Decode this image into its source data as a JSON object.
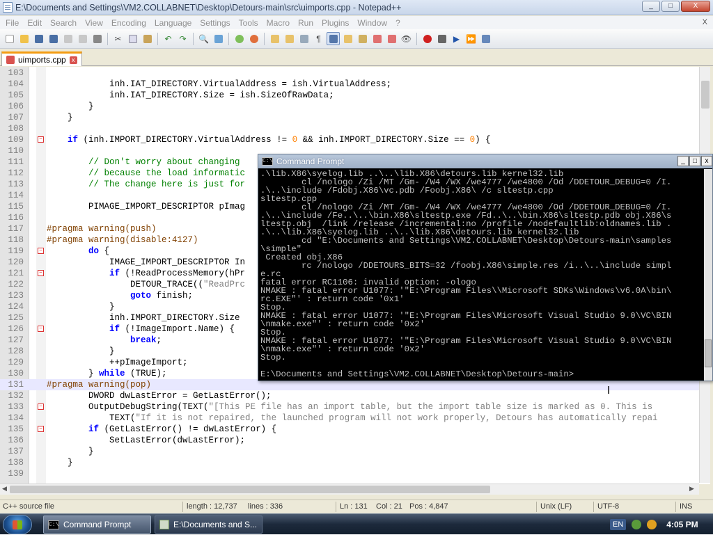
{
  "window": {
    "title": "E:\\Documents and Settings\\VM2.COLLABNET\\Desktop\\Detours-main\\src\\uimports.cpp - Notepad++",
    "min": "_",
    "max": "□",
    "close": "X"
  },
  "menu": [
    "File",
    "Edit",
    "Search",
    "View",
    "Encoding",
    "Language",
    "Settings",
    "Tools",
    "Macro",
    "Run",
    "Plugins",
    "Window",
    "?"
  ],
  "menu_close": "X",
  "tab": {
    "label": "uimports.cpp",
    "close": "x"
  },
  "editor": {
    "lines": [
      {
        "n": "103",
        "h": ""
      },
      {
        "n": "104",
        "h": "            inh.IAT_DIRECTORY.VirtualAddress = ish.VirtualAddress;"
      },
      {
        "n": "105",
        "h": "            inh.IAT_DIRECTORY.Size = ish.SizeOfRawData;"
      },
      {
        "n": "106",
        "h": "        }"
      },
      {
        "n": "107",
        "h": "    }"
      },
      {
        "n": "108",
        "h": ""
      },
      {
        "n": "109",
        "h": "    <span class=\"kw\">if</span> (inh.IMPORT_DIRECTORY.VirtualAddress != <span class=\"nm\">0</span> &amp;&amp; inh.IMPORT_DIRECTORY.Size == <span class=\"nm\">0</span>) {",
        "fold": "-"
      },
      {
        "n": "110",
        "h": ""
      },
      {
        "n": "111",
        "h": "        <span class=\"cm\">// Don't worry about changing</span>"
      },
      {
        "n": "112",
        "h": "        <span class=\"cm\">// because the load informatic</span>"
      },
      {
        "n": "113",
        "h": "        <span class=\"cm\">// The change here is just for</span>"
      },
      {
        "n": "114",
        "h": ""
      },
      {
        "n": "115",
        "h": "        PIMAGE_IMPORT_DESCRIPTOR pImag"
      },
      {
        "n": "116",
        "h": ""
      },
      {
        "n": "117",
        "h": "<span class=\"pp\">#pragma warning(push)</span>"
      },
      {
        "n": "118",
        "h": "<span class=\"pp\">#pragma warning(disable:4127)</span>"
      },
      {
        "n": "119",
        "h": "        <span class=\"kw\">do</span> {",
        "fold": "-"
      },
      {
        "n": "120",
        "h": "            IMAGE_IMPORT_DESCRIPTOR In"
      },
      {
        "n": "121",
        "h": "            <span class=\"kw\">if</span> (!ReadProcessMemory(hPr",
        "fold": "-"
      },
      {
        "n": "122",
        "h": "                DETOUR_TRACE((<span class=\"st\">\"ReadPrc</span>"
      },
      {
        "n": "123",
        "h": "                <span class=\"kw\">goto</span> finish;"
      },
      {
        "n": "124",
        "h": "            }"
      },
      {
        "n": "125",
        "h": "            inh.IMPORT_DIRECTORY.Size"
      },
      {
        "n": "126",
        "h": "            <span class=\"kw\">if</span> (!ImageImport.Name) {",
        "fold": "-"
      },
      {
        "n": "127",
        "h": "                <span class=\"kw\">break</span>;"
      },
      {
        "n": "128",
        "h": "            }"
      },
      {
        "n": "129",
        "h": "            ++pImageImport;"
      },
      {
        "n": "130",
        "h": "        } <span class=\"kw\">while</span> (TRUE);"
      },
      {
        "n": "131",
        "h": "<span class=\"pp\">#pragma warning(pop)</span>",
        "cur": true
      },
      {
        "n": "132",
        "h": "        DWORD dwLastError = GetLastError();"
      },
      {
        "n": "133",
        "h": "        OutputDebugString(TEXT(<span class=\"st\">\"[This PE file has an import table, but the import table size is marked as 0. This is</span>",
        "fold": "-"
      },
      {
        "n": "134",
        "h": "            TEXT(<span class=\"st\">\"If it is not repaired, the launched program will not work properly, Detours has automatically repai</span>"
      },
      {
        "n": "135",
        "h": "        <span class=\"kw\">if</span> (GetLastError() != dwLastError) {",
        "fold": "-"
      },
      {
        "n": "136",
        "h": "            SetLastError(dwLastError);"
      },
      {
        "n": "137",
        "h": "        }"
      },
      {
        "n": "138",
        "h": "    }"
      },
      {
        "n": "139",
        "h": ""
      }
    ]
  },
  "status": {
    "lang": "C++ source file",
    "length": "length : 12,737",
    "lines": "lines : 336",
    "ln": "Ln : 131",
    "col": "Col : 21",
    "pos": "Pos : 4,847",
    "eol": "Unix (LF)",
    "enc": "UTF-8",
    "ins": "INS"
  },
  "cmd": {
    "title": "Command Prompt",
    "icon": "C:\\",
    "lines": [
      ".\\lib.X86\\syelog.lib ..\\..\\lib.X86\\detours.lib kernel32.lib",
      "        cl /nologo /Zi /MT /Gm- /W4 /WX /we4777 /we4800 /Od /DDETOUR_DEBUG=0 /I.",
      ".\\..\\include /Fdobj.X86\\vc.pdb /Foobj.X86\\ /c sltestp.cpp",
      "sltestp.cpp",
      "        cl /nologo /Zi /MT /Gm- /W4 /WX /we4777 /we4800 /Od /DDETOUR_DEBUG=0 /I.",
      ".\\..\\include /Fe..\\..\\bin.X86\\sltestp.exe /Fd..\\..\\bin.X86\\sltestp.pdb obj.X86\\s",
      "ltestp.obj  /link /release /incremental:no /profile /nodefaultlib:oldnames.lib .",
      ".\\..\\lib.X86\\syelog.lib ..\\..\\lib.X86\\detours.lib kernel32.lib",
      "        cd \"E:\\Documents and Settings\\VM2.COLLABNET\\Desktop\\Detours-main\\samples",
      "\\simple\"",
      " Created obj.X86",
      "        rc /nologo /DDETOURS_BITS=32 /foobj.X86\\simple.res /i..\\..\\include simpl",
      "e.rc",
      "fatal error RC1106: invalid option: -ologo",
      "NMAKE : fatal error U1077: '\"E:\\Program Files\\\\Microsoft SDKs\\Windows\\v6.0A\\bin\\",
      "rc.EXE\"' : return code '0x1'",
      "Stop.",
      "NMAKE : fatal error U1077: '\"E:\\Program Files\\Microsoft Visual Studio 9.0\\VC\\BIN",
      "\\nmake.exe\"' : return code '0x2'",
      "Stop.",
      "NMAKE : fatal error U1077: '\"E:\\Program Files\\Microsoft Visual Studio 9.0\\VC\\BIN",
      "\\nmake.exe\"' : return code '0x2'",
      "Stop.",
      "",
      "E:\\Documents and Settings\\VM2.COLLABNET\\Desktop\\Detours-main>"
    ]
  },
  "taskbar": {
    "items": [
      {
        "label": "Command Prompt",
        "icon": "C:\\"
      },
      {
        "label": "E:\\Documents and S..."
      }
    ],
    "lang": "EN",
    "clock": "4:05 PM"
  },
  "colors": {
    "accent": "#f39c12",
    "cmd_bg": "#000000",
    "keyword": "#0000ff",
    "comment": "#008000"
  }
}
